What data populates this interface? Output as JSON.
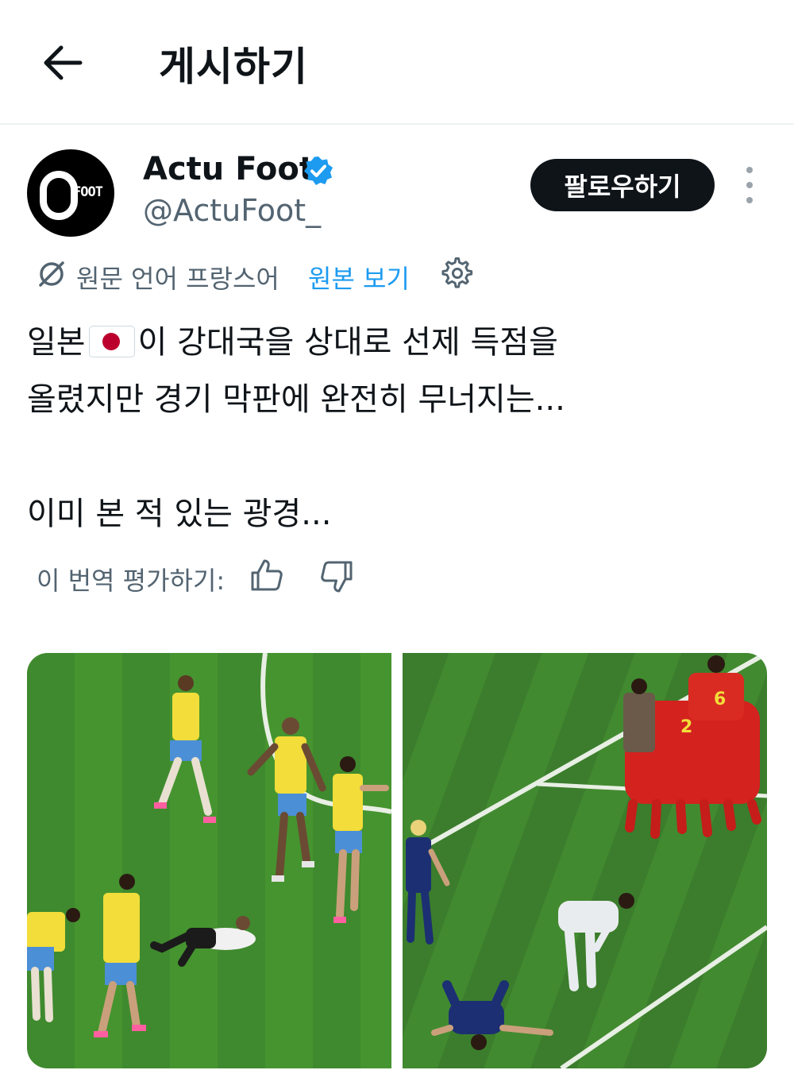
{
  "header": {
    "title": "게시하기",
    "back_icon": "arrow-left-icon"
  },
  "author": {
    "display_name": "Actu Foot",
    "handle": "@ActuFoot_",
    "avatar_text": "FOOT",
    "verified": true,
    "verified_color": "#1d9bf0"
  },
  "actions": {
    "follow_label": "팔로우하기",
    "more_icon": "more-vertical-icon"
  },
  "translation": {
    "source_language": "원문 언어 프랑스어",
    "show_original": "원본 보기",
    "settings_icon": "gear-icon",
    "rate_label": "이 번역 평가하기:",
    "thumbs_up_icon": "thumbs-up-icon",
    "thumbs_down_icon": "thumbs-down-icon"
  },
  "tweet": {
    "line1_pre": "일본",
    "flag_icon": "japan-flag-icon",
    "line1_post": "이 강대국을 상대로 선제 득점을",
    "line2": "올렸지만 경기 막판에 완전히 무너지는...",
    "line3": "이미 본 적 있는 광경..."
  },
  "media": {
    "count": 2,
    "accent_colors": {
      "pitch": "#3f8a2e",
      "brazil_shirt": "#f2dd3a",
      "brazil_shorts": "#4b8fd6",
      "germany_shirt": "#f2f2f2",
      "japan_shirt": "#1c2f72",
      "belgium_shirt": "#d4221e"
    },
    "left_image_desc": "brazil-players-and-fallen-player-photo",
    "right_image_desc": "belgium-celebration-japan-players-down-photo"
  }
}
